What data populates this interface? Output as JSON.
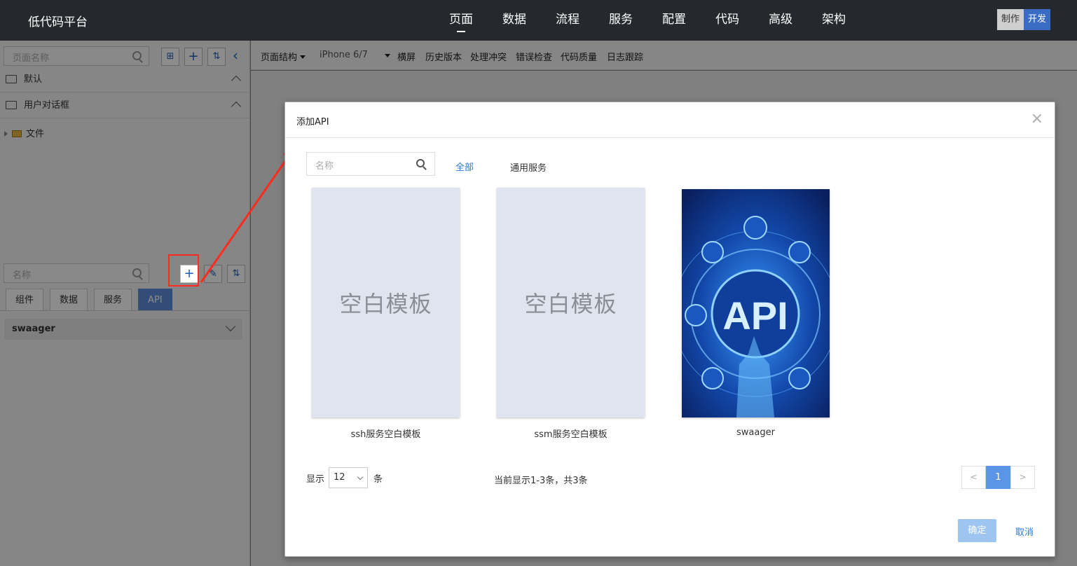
{
  "header": {
    "brand": "低代码平台",
    "nav": [
      "页面",
      "数据",
      "流程",
      "服务",
      "配置",
      "代码",
      "高级",
      "架构"
    ],
    "active_nav": "页面",
    "mode_make": "制作",
    "mode_dev": "开发"
  },
  "left_panel": {
    "page_search_placeholder": "页面名称",
    "tree": [
      {
        "label": "默认"
      },
      {
        "label": "用户对话框"
      }
    ],
    "file_label": "文件",
    "component_search_placeholder": "名称",
    "tabs": [
      "组件",
      "数据",
      "服务",
      "API"
    ],
    "active_tab": "API",
    "group_label": "swaager"
  },
  "toolbar": {
    "structure_label": "页面结构",
    "device_label": "iPhone 6/7",
    "items": [
      "横屏",
      "历史版本",
      "处理冲突",
      "错误检查",
      "代码质量",
      "日志跟踪"
    ]
  },
  "modal": {
    "title": "添加API",
    "close_label": "×",
    "search_placeholder": "名称",
    "filters": [
      "全部",
      "通用服务"
    ],
    "active_filter": "全部",
    "cards": [
      {
        "thumb_text": "空白模板",
        "name": "ssh服务空白模板"
      },
      {
        "thumb_text": "空白模板",
        "name": "ssm服务空白模板"
      },
      {
        "thumb_text": "API",
        "name": "swaager"
      }
    ],
    "pager": {
      "show_label": "显示",
      "page_size": "12",
      "unit_label": "条",
      "info": "当前显示1-3条，共3条",
      "prev": "<",
      "current_page": "1",
      "next": ">"
    },
    "confirm_label": "确定",
    "cancel_label": "取消"
  },
  "colors": {
    "topbar": "#25282d",
    "accent": "#2d7ad6",
    "annotation": "#ff2b1f"
  }
}
